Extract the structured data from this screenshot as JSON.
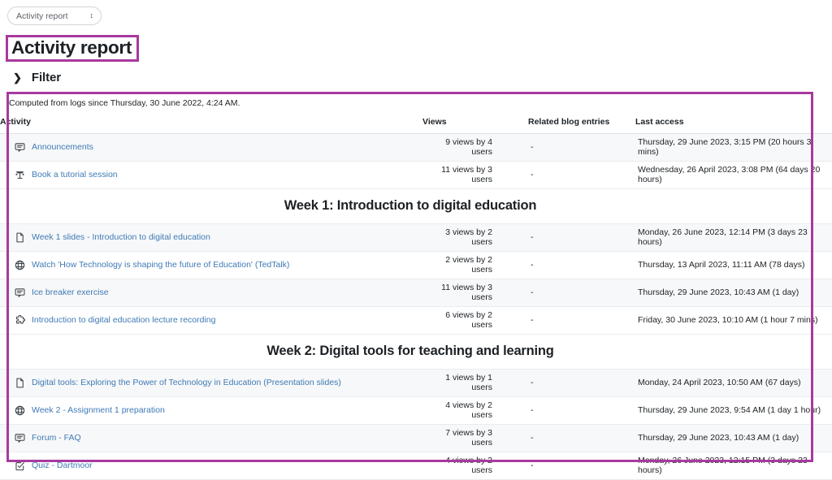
{
  "jump_menu": {
    "selected": "Activity report",
    "caret_icon": "updown-caret-icon"
  },
  "header": {
    "title": "Activity report"
  },
  "filter": {
    "label": "Filter",
    "chevron_icon": "chevron-right-icon",
    "expanded": false
  },
  "report": {
    "computed_note": "Computed from logs since Thursday, 30 June 2022, 4:24 AM.",
    "columns": {
      "activity": "Activity",
      "views": "Views",
      "blog": "Related blog entries",
      "last_access": "Last access"
    },
    "rows": [
      {
        "kind": "activity",
        "icon": "forum-icon",
        "name": "Announcements",
        "views": "9 views by 4 users",
        "blog": "-",
        "last_access": "Thursday, 29 June 2023, 3:15 PM (20 hours 3 mins)"
      },
      {
        "kind": "activity",
        "icon": "scheduler-icon",
        "name": "Book a tutorial session",
        "views": "11 views by 3 users",
        "blog": "-",
        "last_access": "Wednesday, 26 April 2023, 3:08 PM (64 days 20 hours)"
      },
      {
        "kind": "section",
        "title": "Week 1: Introduction to digital education"
      },
      {
        "kind": "activity",
        "icon": "file-icon",
        "name": "Week 1 slides - Introduction to digital education",
        "views": "3 views by 2 users",
        "blog": "-",
        "last_access": "Monday, 26 June 2023, 12:14 PM (3 days 23 hours)"
      },
      {
        "kind": "activity",
        "icon": "url-globe-icon",
        "name": "Watch 'How Technology is shaping the future of Education' (TedTalk)",
        "views": "2 views by 2 users",
        "blog": "-",
        "last_access": "Thursday, 13 April 2023, 11:11 AM (78 days)"
      },
      {
        "kind": "activity",
        "icon": "forum-icon",
        "name": "Ice breaker exercise",
        "views": "11 views by 3 users",
        "blog": "-",
        "last_access": "Thursday, 29 June 2023, 10:43 AM (1 day)"
      },
      {
        "kind": "activity",
        "icon": "puzzle-external-tool-icon",
        "name": "Introduction to digital education lecture recording",
        "views": "6 views by 2 users",
        "blog": "-",
        "last_access": "Friday, 30 June 2023, 10:10 AM (1 hour 7 mins)"
      },
      {
        "kind": "section",
        "title": "Week 2: Digital tools for teaching and learning"
      },
      {
        "kind": "activity",
        "icon": "file-icon",
        "name": "Digital tools: Exploring  the Power of Technology in Education (Presentation slides)",
        "views": "1 views by 1 users",
        "blog": "-",
        "last_access": "Monday, 24 April 2023, 10:50 AM (67 days)"
      },
      {
        "kind": "activity",
        "icon": "url-globe-icon",
        "name": "Week 2 - Assignment 1 preparation",
        "views": "4 views by 2 users",
        "blog": "-",
        "last_access": "Thursday, 29 June 2023, 9:54 AM (1 day 1 hour)"
      },
      {
        "kind": "activity",
        "icon": "forum-icon",
        "name": "Forum - FAQ",
        "views": "7 views by 3 users",
        "blog": "-",
        "last_access": "Thursday, 29 June 2023, 10:43 AM (1 day)"
      },
      {
        "kind": "activity",
        "icon": "quiz-icon",
        "name": "Quiz - Dartmoor",
        "views": "4 views by 2 users",
        "blog": "-",
        "last_access": "Monday, 26 June 2023, 12:15 PM (3 days 23 hours)"
      }
    ]
  },
  "colors": {
    "highlight": "#a8399f",
    "link": "#3f7ab5",
    "text": "#1d2125",
    "row_zebra": "#f7f8f9"
  }
}
